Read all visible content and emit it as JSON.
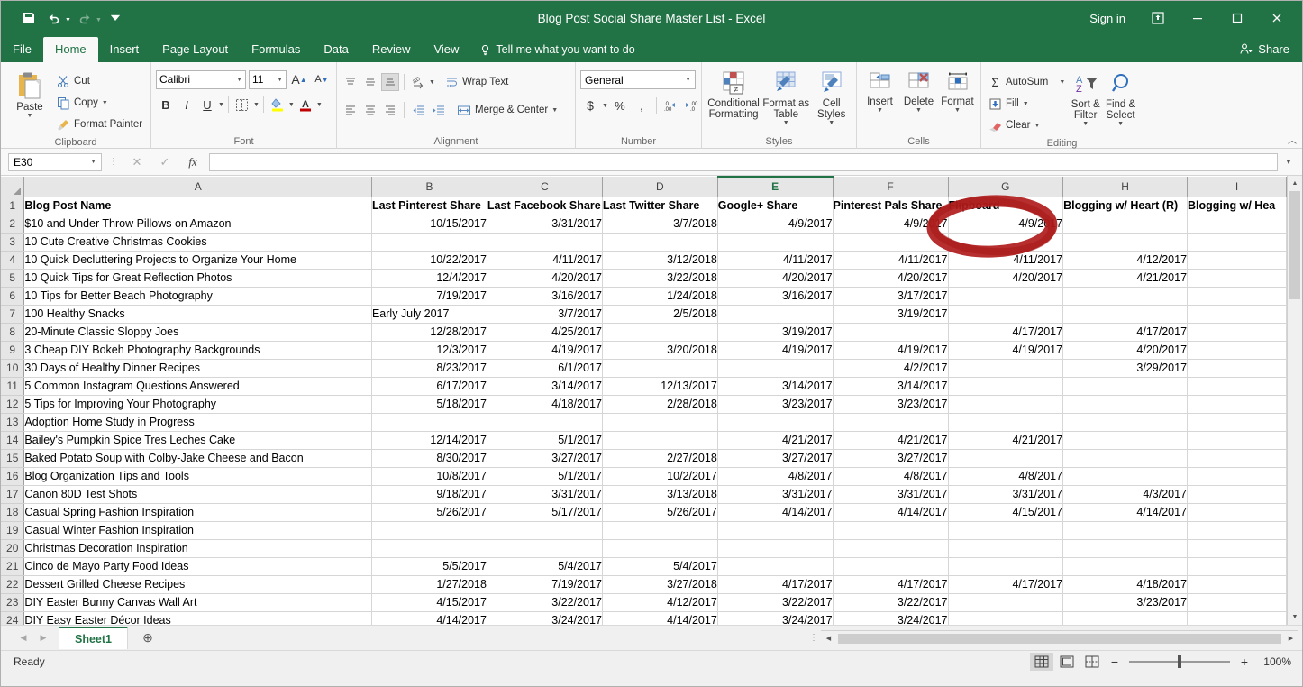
{
  "window": {
    "title": "Blog Post Social Share Master List  -  Excel",
    "sign_in": "Sign in",
    "minimize_icon": "minimize-icon",
    "maximize_icon": "maximize-icon",
    "close_icon": "close-icon",
    "ribbon_display_icon": "ribbon-display-options-icon"
  },
  "quick_access": {
    "save_icon": "save-icon",
    "undo_icon": "undo-icon",
    "redo_icon": "redo-icon",
    "customize_icon": "customize-quick-access-toolbar-icon"
  },
  "tabs": [
    {
      "label": "File",
      "active": false
    },
    {
      "label": "Home",
      "active": true
    },
    {
      "label": "Insert",
      "active": false
    },
    {
      "label": "Page Layout",
      "active": false
    },
    {
      "label": "Formulas",
      "active": false
    },
    {
      "label": "Data",
      "active": false
    },
    {
      "label": "Review",
      "active": false
    },
    {
      "label": "View",
      "active": false
    }
  ],
  "tell_me": "Tell me what you want to do",
  "share": "Share",
  "ribbon": {
    "clipboard": {
      "label": "Clipboard",
      "paste": "Paste",
      "cut": "Cut",
      "copy": "Copy",
      "format_painter": "Format Painter"
    },
    "font": {
      "label": "Font",
      "font_name": "Calibri",
      "font_size": "11",
      "grow_font": "A",
      "shrink_font": "A",
      "bold": "B",
      "italic": "I",
      "underline": "U"
    },
    "alignment": {
      "label": "Alignment",
      "wrap_text": "Wrap Text",
      "merge_center": "Merge & Center"
    },
    "number": {
      "label": "Number",
      "format": "General",
      "currency": "$",
      "percent": "%",
      "comma": ","
    },
    "styles": {
      "label": "Styles",
      "conditional_formatting": "Conditional Formatting",
      "format_as_table": "Format as Table",
      "cell_styles": "Cell Styles"
    },
    "cells": {
      "label": "Cells",
      "insert": "Insert",
      "delete": "Delete",
      "format": "Format"
    },
    "editing": {
      "label": "Editing",
      "autosum": "AutoSum",
      "fill": "Fill",
      "clear": "Clear",
      "sort_filter": "Sort & Filter",
      "find_select": "Find & Select"
    }
  },
  "formula_bar": {
    "name_box": "E30",
    "formula": "",
    "cancel_icon": "cancel-icon",
    "enter_icon": "enter-icon",
    "function_icon": "insert-function-icon"
  },
  "grid": {
    "column_letters": [
      "A",
      "B",
      "C",
      "D",
      "E",
      "F",
      "G",
      "H",
      "I"
    ],
    "active_column": "E",
    "row_numbers": [
      1,
      2,
      3,
      4,
      5,
      6,
      7,
      8,
      9,
      10,
      11,
      12,
      13,
      14,
      15,
      16,
      17,
      18,
      19,
      20,
      21,
      22,
      23,
      24
    ],
    "headers": [
      "Blog Post Name",
      "Last Pinterest Share",
      "Last Facebook Share",
      "Last Twitter Share",
      "Google+ Share",
      "Pinterest Pals Share",
      "Flipboard",
      "Blogging w/ Heart (R)",
      "Blogging w/ Hea"
    ],
    "rows": [
      [
        "$10 and Under Throw Pillows on Amazon",
        "10/15/2017",
        "3/31/2017",
        "3/7/2018",
        "4/9/2017",
        "4/9/2017",
        "4/9/2017",
        "",
        ""
      ],
      [
        "10 Cute Creative Christmas Cookies",
        "",
        "",
        "",
        "",
        "",
        "",
        "",
        ""
      ],
      [
        "10 Quick Decluttering Projects to Organize Your Home",
        "10/22/2017",
        "4/11/2017",
        "3/12/2018",
        "4/11/2017",
        "4/11/2017",
        "4/11/2017",
        "4/12/2017",
        ""
      ],
      [
        "10 Quick Tips for Great Reflection Photos",
        "12/4/2017",
        "4/20/2017",
        "3/22/2018",
        "4/20/2017",
        "4/20/2017",
        "4/20/2017",
        "4/21/2017",
        ""
      ],
      [
        "10 Tips for Better Beach Photography",
        "7/19/2017",
        "3/16/2017",
        "1/24/2018",
        "3/16/2017",
        "3/17/2017",
        "",
        "",
        ""
      ],
      [
        "100 Healthy Snacks",
        "Early July 2017",
        "3/7/2017",
        "2/5/2018",
        "",
        "3/19/2017",
        "",
        "",
        ""
      ],
      [
        "20-Minute Classic Sloppy Joes",
        "12/28/2017",
        "4/25/2017",
        "",
        "3/19/2017",
        "",
        "4/17/2017",
        "4/17/2017",
        ""
      ],
      [
        "3 Cheap DIY Bokeh Photography Backgrounds",
        "12/3/2017",
        "4/19/2017",
        "3/20/2018",
        "4/19/2017",
        "4/19/2017",
        "4/19/2017",
        "4/20/2017",
        ""
      ],
      [
        "30 Days of Healthy Dinner Recipes",
        "8/23/2017",
        "6/1/2017",
        "",
        "",
        "4/2/2017",
        "",
        "3/29/2017",
        ""
      ],
      [
        "5 Common Instagram Questions Answered",
        "6/17/2017",
        "3/14/2017",
        "12/13/2017",
        "3/14/2017",
        "3/14/2017",
        "",
        "",
        ""
      ],
      [
        "5 Tips for Improving Your Photography",
        "5/18/2017",
        "4/18/2017",
        "2/28/2018",
        "3/23/2017",
        "3/23/2017",
        "",
        "",
        ""
      ],
      [
        "Adoption Home Study in Progress",
        "",
        "",
        "",
        "",
        "",
        "",
        "",
        ""
      ],
      [
        "Bailey's Pumpkin Spice Tres Leches Cake",
        "12/14/2017",
        "5/1/2017",
        "",
        "4/21/2017",
        "4/21/2017",
        "4/21/2017",
        "",
        ""
      ],
      [
        "Baked Potato Soup with Colby-Jake Cheese and Bacon",
        "8/30/2017",
        "3/27/2017",
        "2/27/2018",
        "3/27/2017",
        "3/27/2017",
        "",
        "",
        ""
      ],
      [
        "Blog Organization Tips and Tools",
        "10/8/2017",
        "5/1/2017",
        "10/2/2017",
        "4/8/2017",
        "4/8/2017",
        "4/8/2017",
        "",
        ""
      ],
      [
        "Canon 80D Test Shots",
        "9/18/2017",
        "3/31/2017",
        "3/13/2018",
        "3/31/2017",
        "3/31/2017",
        "3/31/2017",
        "4/3/2017",
        ""
      ],
      [
        "Casual Spring Fashion Inspiration",
        "5/26/2017",
        "5/17/2017",
        "5/26/2017",
        "4/14/2017",
        "4/14/2017",
        "4/15/2017",
        "4/14/2017",
        ""
      ],
      [
        "Casual Winter Fashion Inspiration",
        "",
        "",
        "",
        "",
        "",
        "",
        "",
        ""
      ],
      [
        "Christmas Decoration Inspiration",
        "",
        "",
        "",
        "",
        "",
        "",
        "",
        ""
      ],
      [
        "Cinco de Mayo Party Food Ideas",
        "5/5/2017",
        "5/4/2017",
        "5/4/2017",
        "",
        "",
        "",
        "",
        ""
      ],
      [
        "Dessert Grilled Cheese Recipes",
        "1/27/2018",
        "7/19/2017",
        "3/27/2018",
        "4/17/2017",
        "4/17/2017",
        "4/17/2017",
        "4/18/2017",
        ""
      ],
      [
        "DIY Easter Bunny Canvas Wall Art",
        "4/15/2017",
        "3/22/2017",
        "4/12/2017",
        "3/22/2017",
        "3/22/2017",
        "",
        "3/23/2017",
        ""
      ],
      [
        "DIY Easy Easter Décor Ideas",
        "4/14/2017",
        "3/24/2017",
        "4/14/2017",
        "3/24/2017",
        "3/24/2017",
        "",
        "",
        ""
      ]
    ]
  },
  "annotation": {
    "shape": "hand-drawn-ellipse",
    "color": "#b01c1c",
    "target": "Flipboard"
  },
  "sheet_tabs": {
    "prev_icon": "previous-sheet-icon",
    "next_icon": "next-sheet-icon",
    "sheets": [
      "Sheet1"
    ],
    "active_sheet": "Sheet1",
    "add_sheet_icon": "add-sheet-icon"
  },
  "status_bar": {
    "status": "Ready",
    "normal_view_icon": "normal-view-icon",
    "page_layout_icon": "page-layout-view-icon",
    "page_break_icon": "page-break-preview-icon",
    "zoom_out": "−",
    "zoom_in": "+",
    "zoom_level": "100%"
  }
}
